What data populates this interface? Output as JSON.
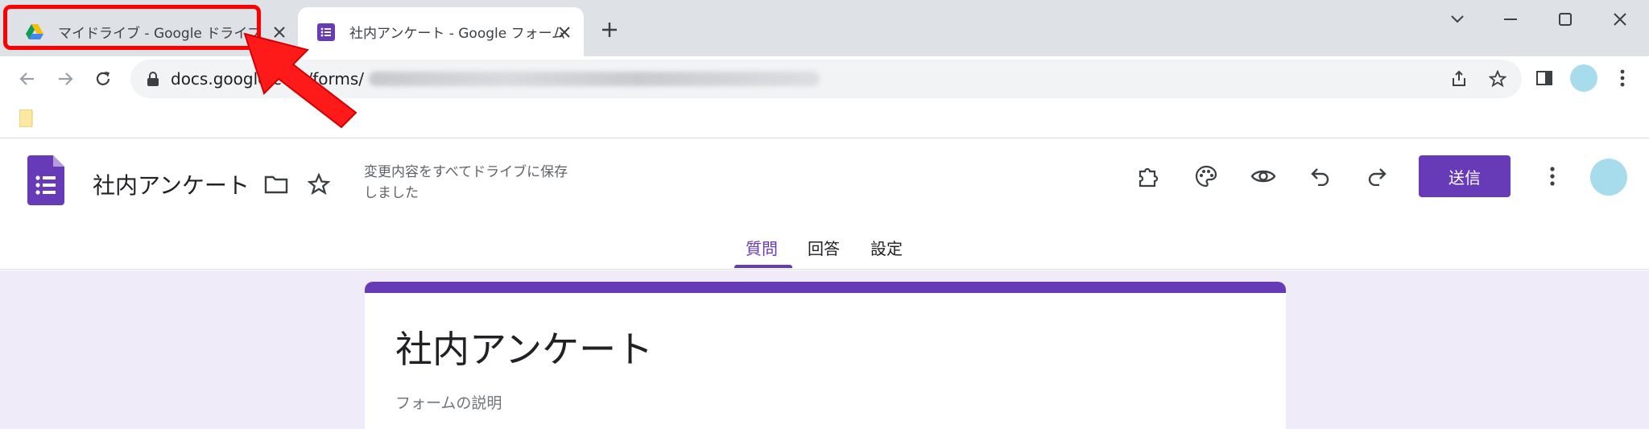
{
  "browser": {
    "tabs": [
      {
        "title": "マイドライブ - Google ドライブ",
        "favicon": "google-drive-icon",
        "active": false
      },
      {
        "title": "社内アンケート - Google フォーム",
        "favicon": "google-forms-icon",
        "active": true
      }
    ],
    "new_tab_icon": "plus-icon",
    "url_visible": "docs.google.com/forms/",
    "colors": {
      "tabstrip": "#dee1e6",
      "highlight": "#ff0000"
    }
  },
  "forms": {
    "doc_title": "社内アンケート",
    "save_status": "変更内容をすべてドライブに保存しました",
    "send_label": "送信",
    "tabs": [
      {
        "label": "質問",
        "active": true
      },
      {
        "label": "回答",
        "active": false
      },
      {
        "label": "設定",
        "active": false
      }
    ],
    "accent_color": "#673ab7",
    "background_color": "#f0ebf8"
  },
  "form_card": {
    "title": "社内アンケート",
    "description_placeholder": "フォームの説明"
  }
}
